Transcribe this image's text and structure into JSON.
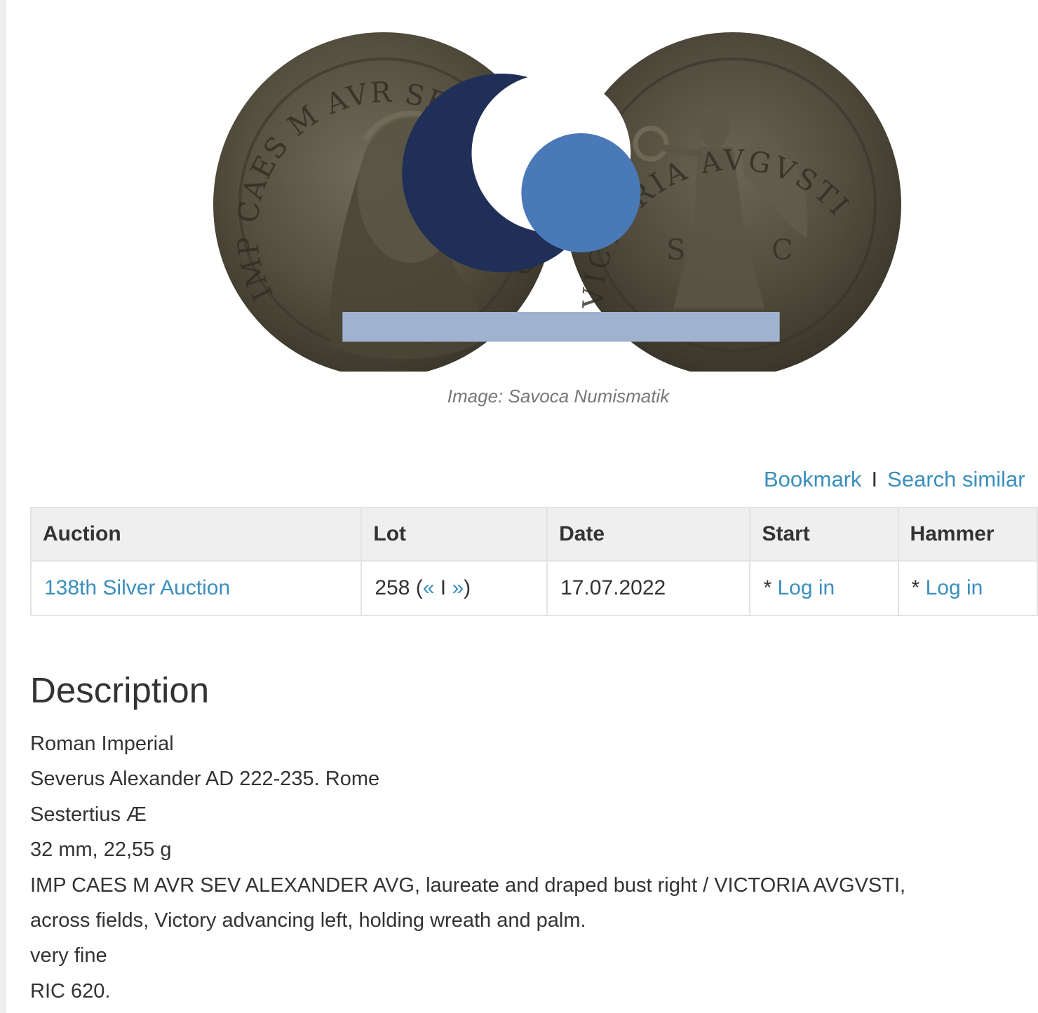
{
  "image": {
    "caption": "Image: Savoca Numismatik",
    "watermark_icon": "savoca-logo-icon",
    "obverse_legend": "IMP CAES M AVR SEV ALEXANDER AVG",
    "reverse_legend": "VICTORIA AVGVSTI"
  },
  "actions": {
    "bookmark": "Bookmark",
    "separator": "I",
    "search_similar": "Search similar"
  },
  "table": {
    "headers": [
      "Auction",
      "Lot",
      "Date",
      "Start",
      "Hammer"
    ],
    "row": {
      "auction": "138th Silver Auction",
      "lot_number": "258",
      "lot_prev": "«",
      "lot_sep": "I",
      "lot_next": "»",
      "date": "17.07.2022",
      "start_prefix": "*",
      "start_link": "Log in",
      "hammer_prefix": "*",
      "hammer_link": "Log in"
    }
  },
  "description": {
    "title": "Description",
    "lines": [
      "Roman Imperial",
      "Severus Alexander AD 222-235. Rome",
      "Sestertius Æ",
      "32 mm, 22,55 g",
      "IMP CAES M AVR SEV ALEXANDER AVG, laureate and draped bust right / VICTORIA AVGVSTI,",
      "across fields, Victory advancing left, holding wreath and palm.",
      "very fine",
      "RIC 620."
    ]
  },
  "colors": {
    "link": "#3a8fbd",
    "text": "#333333",
    "header_bg": "#efefef",
    "border": "#e3e3e3"
  }
}
